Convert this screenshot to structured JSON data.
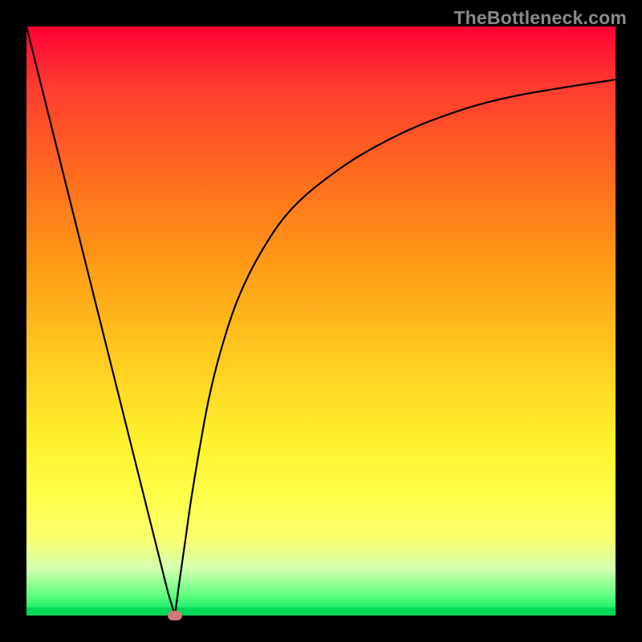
{
  "watermark": "TheBottleneck.com",
  "chart_data": {
    "type": "line",
    "title": "",
    "xlabel": "",
    "ylabel": "",
    "xlim": [
      0,
      100
    ],
    "ylim": [
      0,
      100
    ],
    "grid": false,
    "legend": false,
    "series": [
      {
        "name": "left-branch",
        "x": [
          0,
          2,
          5,
          8,
          11,
          14,
          17,
          20,
          22,
          24,
          25.2
        ],
        "y": [
          100,
          92,
          80,
          68,
          56,
          44,
          32,
          20,
          12,
          4,
          0
        ]
      },
      {
        "name": "right-branch",
        "x": [
          25.2,
          26,
          27,
          28,
          29.5,
          31,
          33,
          36,
          40,
          45,
          52,
          60,
          70,
          82,
          100
        ],
        "y": [
          0,
          6,
          13,
          20,
          29,
          37,
          45,
          54,
          62,
          69,
          75,
          80,
          84.5,
          88,
          91
        ]
      }
    ],
    "minimum_marker": {
      "x": 25.2,
      "y": 0
    },
    "colors": {
      "curve": "#000000",
      "marker": "#cc7a75",
      "gradient_top": "#ff0033",
      "gradient_mid": "#ffd633",
      "gradient_bottom": "#00d858"
    }
  }
}
